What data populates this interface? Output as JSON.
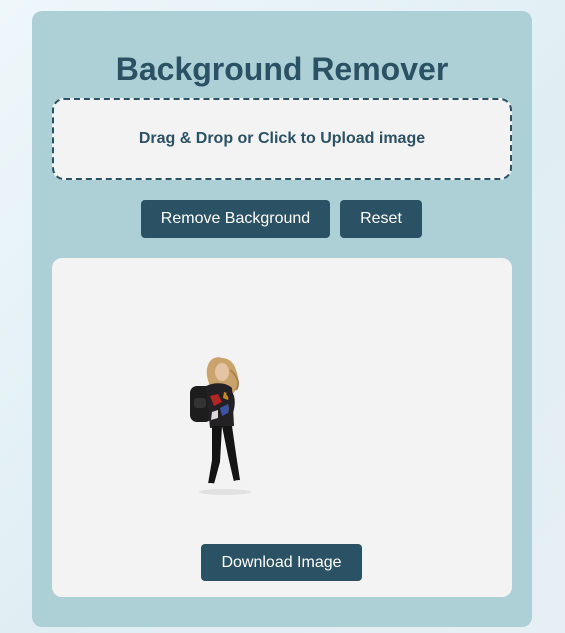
{
  "app": {
    "title": "Background Remover"
  },
  "upload": {
    "label": "Drag & Drop or Click to Upload image"
  },
  "actions": {
    "remove_label": "Remove Background",
    "reset_label": "Reset"
  },
  "preview": {
    "download_label": "Download Image",
    "image_subject": "person-with-backpack-cutout"
  },
  "colors": {
    "card": "#acd0d5",
    "accent": "#2b5264",
    "panel": "#f3f3f3"
  }
}
